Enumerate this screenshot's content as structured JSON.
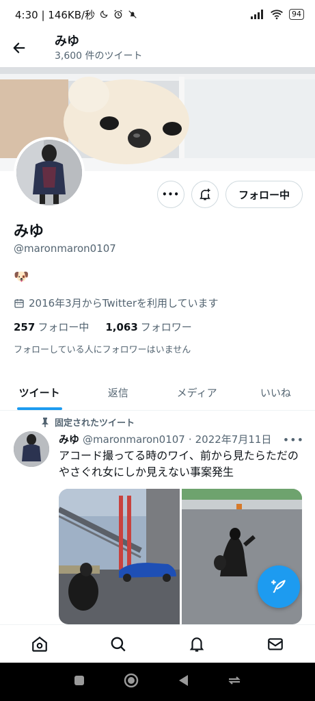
{
  "status": {
    "time_speed": "4:30 | 146KB/秒",
    "battery": "94"
  },
  "header": {
    "name": "みゆ",
    "tweet_count": "3,600 件のツイート"
  },
  "profile": {
    "name": "みゆ",
    "handle": "@maronmaron0107",
    "bio_emoji": "🐶",
    "joined": "2016年3月からTwitterを利用しています",
    "following_count": "257",
    "following_label": "フォロー中",
    "followers_count": "1,063",
    "followers_label": "フォロワー",
    "no_mutuals": "フォローしている人にフォロワーはいません"
  },
  "actions": {
    "follow_label": "フォロー中",
    "more_label": "•••"
  },
  "tabs": [
    {
      "label": "ツイート"
    },
    {
      "label": "返信"
    },
    {
      "label": "メディア"
    },
    {
      "label": "いいね"
    }
  ],
  "tweet": {
    "pinned_label": "固定されたツイート",
    "name": "みゆ",
    "handle": "@maronmaron0107",
    "separator": "·",
    "date": "2022年7月11日",
    "more": "•••",
    "text": "アコード撮ってる時のワイ、前から見たらただのやさぐれ女にしか見えない事案発生"
  },
  "nav": {
    "items": [
      "home-icon",
      "search-icon",
      "bell-icon",
      "mail-icon"
    ]
  },
  "colors": {
    "accent": "#1d9bf0",
    "text": "#0f1419",
    "secondary": "#536471"
  }
}
